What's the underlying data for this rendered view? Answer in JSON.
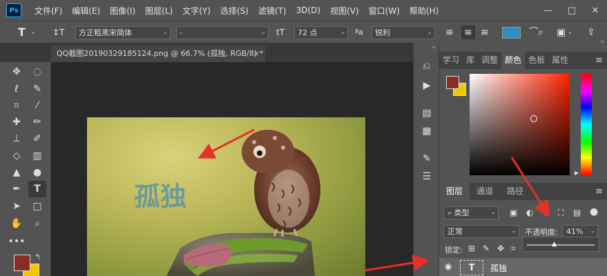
{
  "app": {
    "logo": "Ps"
  },
  "menu": [
    "文件(F)",
    "编辑(E)",
    "图像(I)",
    "图层(L)",
    "文字(Y)",
    "选择(S)",
    "滤镜(T)",
    "3D(D)",
    "视图(V)",
    "窗口(W)",
    "帮助(H)"
  ],
  "window_controls": {
    "minimize": "—",
    "maximize": "□",
    "close": "✕"
  },
  "options": {
    "tool_icon": "T",
    "orient_icon": "↕T",
    "font_family": "方正粗黑宋简体",
    "font_style": "-",
    "size_icon": "tT",
    "font_size": "72 点",
    "aa_icon": "ªa",
    "antialias": "锐利",
    "text_color": "#2b8fc4"
  },
  "document": {
    "tab_title": "QQ截图20190329185124.png @ 66.7% (孤独, RGB/8) *",
    "close": "×",
    "text_layer_content": "孤独"
  },
  "color_panel": {
    "tabs": [
      "学习",
      "库",
      "调整",
      "颜色",
      "色板",
      "属性"
    ],
    "active_tab": "颜色",
    "foreground": "#8b2e22",
    "background": "#f0c800"
  },
  "layers_panel": {
    "tabs": [
      "图层",
      "通道",
      "路径"
    ],
    "active_tab": "图层",
    "filter_kind": "类型",
    "blend_mode": "正常",
    "opacity_label": "不透明度:",
    "opacity_value": "41%",
    "lock_label": "锁定:",
    "layer": {
      "thumb": "T",
      "name": "孤独"
    }
  },
  "colors": {
    "menubar": "#535353",
    "canvas_bg": "#282828",
    "arrow": "#e8302a"
  }
}
